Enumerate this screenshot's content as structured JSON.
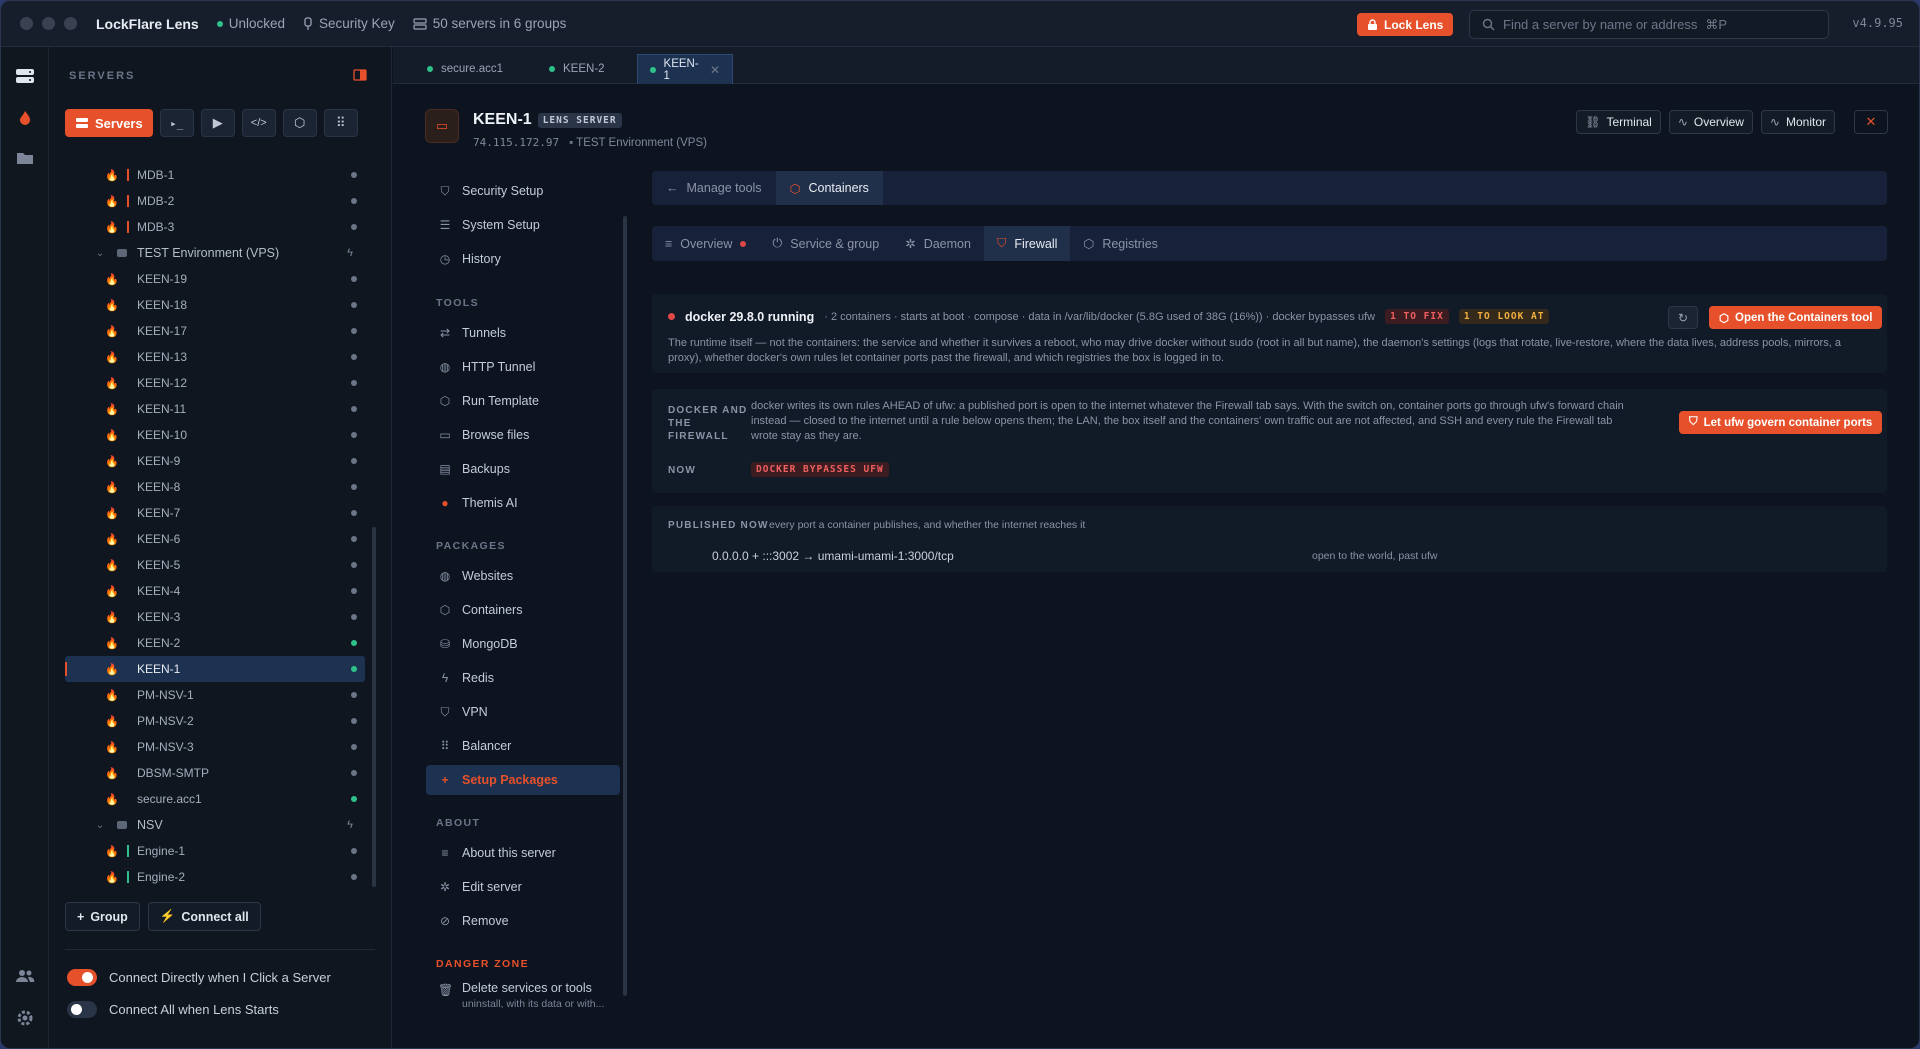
{
  "window": {
    "app_title": "LockFlare Lens",
    "status_unlocked": "Unlocked",
    "security_key": "Security Key",
    "servers_count": "50 servers in 6 groups",
    "lock_button": "Lock Lens",
    "search_placeholder": "Find a server by name or address",
    "search_shortcut": "⌘P",
    "version": "v4.9.95"
  },
  "sidebar": {
    "heading": "SERVERS",
    "servers_button": "Servers",
    "tree": [
      {
        "type": "server",
        "name": "MDB-1",
        "bar": "#e6502a",
        "online": false
      },
      {
        "type": "server",
        "name": "MDB-2",
        "bar": "#e6502a",
        "online": false
      },
      {
        "type": "server",
        "name": "MDB-3",
        "bar": "#e6502a",
        "online": false
      },
      {
        "type": "group",
        "name": "TEST Environment (VPS)"
      },
      {
        "type": "server",
        "name": "KEEN-19",
        "online": false
      },
      {
        "type": "server",
        "name": "KEEN-18",
        "online": false
      },
      {
        "type": "server",
        "name": "KEEN-17",
        "online": false
      },
      {
        "type": "server",
        "name": "KEEN-13",
        "online": false
      },
      {
        "type": "server",
        "name": "KEEN-12",
        "online": false
      },
      {
        "type": "server",
        "name": "KEEN-11",
        "online": false
      },
      {
        "type": "server",
        "name": "KEEN-10",
        "online": false
      },
      {
        "type": "server",
        "name": "KEEN-9",
        "online": false
      },
      {
        "type": "server",
        "name": "KEEN-8",
        "online": false
      },
      {
        "type": "server",
        "name": "KEEN-7",
        "online": false
      },
      {
        "type": "server",
        "name": "KEEN-6",
        "online": false
      },
      {
        "type": "server",
        "name": "KEEN-5",
        "online": false
      },
      {
        "type": "server",
        "name": "KEEN-4",
        "online": false
      },
      {
        "type": "server",
        "name": "KEEN-3",
        "online": false
      },
      {
        "type": "server",
        "name": "KEEN-2",
        "online": true
      },
      {
        "type": "server",
        "name": "KEEN-1",
        "online": true,
        "selected": true
      },
      {
        "type": "server",
        "name": "PM-NSV-1",
        "online": false
      },
      {
        "type": "server",
        "name": "PM-NSV-2",
        "online": false
      },
      {
        "type": "server",
        "name": "PM-NSV-3",
        "online": false
      },
      {
        "type": "server",
        "name": "DBSM-SMTP",
        "online": false
      },
      {
        "type": "server",
        "name": "secure.acc1",
        "online": true
      },
      {
        "type": "group",
        "name": "NSV"
      },
      {
        "type": "server",
        "name": "Engine-1",
        "bar": "#2ec28a",
        "online": false
      },
      {
        "type": "server",
        "name": "Engine-2",
        "bar": "#2ec28a",
        "online": false
      }
    ],
    "group_button": "Group",
    "connect_all_button": "Connect all",
    "toggle_connect_click": "Connect Directly when I Click a Server",
    "toggle_connect_start": "Connect All when Lens Starts"
  },
  "tabs": [
    {
      "label": "secure.acc1",
      "active": false
    },
    {
      "label": "KEEN-2",
      "active": false
    },
    {
      "label": "KEEN-1",
      "active": true
    }
  ],
  "server": {
    "name": "KEEN-1",
    "badge": "LENS SERVER",
    "ip": "74.115.172.97",
    "group": "TEST Environment (VPS)",
    "btn_terminal": "Terminal",
    "btn_overview": "Overview",
    "btn_monitor": "Monitor"
  },
  "submenu": {
    "security_setup": "Security Setup",
    "system_setup": "System Setup",
    "history": "History",
    "tools_label": "TOOLS",
    "tunnels": "Tunnels",
    "http_tunnel": "HTTP Tunnel",
    "run_template": "Run Template",
    "browse_files": "Browse files",
    "backups": "Backups",
    "themis_ai": "Themis AI",
    "packages_label": "PACKAGES",
    "websites": "Websites",
    "containers": "Containers",
    "mongodb": "MongoDB",
    "redis": "Redis",
    "vpn": "VPN",
    "balancer": "Balancer",
    "setup_packages": "Setup Packages",
    "about_label": "ABOUT",
    "about_server": "About this server",
    "edit_server": "Edit server",
    "remove": "Remove",
    "danger_label": "DANGER ZONE",
    "delete_services": "Delete services or tools",
    "delete_sub": "uninstall, with its data or with..."
  },
  "main": {
    "manage_tools": "Manage tools",
    "containers": "Containers",
    "subtab_overview": "Overview",
    "subtab_service": "Service & group",
    "subtab_daemon": "Daemon",
    "subtab_firewall": "Firewall",
    "subtab_registries": "Registries",
    "docker_title": "docker 29.8.0 running",
    "docker_meta": "· 2 containers · starts at boot · compose · data in /var/lib/docker (5.8G used of 38G (16%)) · docker bypasses ufw",
    "pill_fix": "1 TO FIX",
    "pill_look": "1 TO LOOK AT",
    "open_containers_btn": "Open the Containers tool",
    "docker_desc_1": "The runtime itself — not the containers: the service and whether it survives a reboot, who may drive docker without sudo (root in all but name), the daemon's settings (logs that rotate, live-restore, where the data lives, address pools, mirrors, a",
    "docker_desc_2": "proxy), whether docker's own rules let container ports past the firewall, and which registries the box is logged in to.",
    "fw_label_1": "DOCKER AND",
    "fw_label_2": "THE",
    "fw_label_3": "FIREWALL",
    "fw_desc_1": "docker writes its own rules AHEAD of ufw: a published port is open to the internet whatever the Firewall tab says. With the switch on, container ports go through ufw's forward chain",
    "fw_desc_2": "instead — closed to the internet until a rule below opens them; the LAN, the box itself and the containers' own traffic out are not affected, and SSH and every rule the Firewall tab",
    "fw_desc_3": "wrote stay as they are.",
    "ufw_btn": "Let ufw govern container ports",
    "now_label": "NOW",
    "now_pill": "DOCKER BYPASSES UFW",
    "published_label": "PUBLISHED NOW",
    "published_desc": "every port a container publishes, and whether the internet reaches it",
    "port_mapping": "0.0.0.0 + :::3002 → umami-umami-1:3000/tcp",
    "port_status": "open to the world, past ufw"
  }
}
